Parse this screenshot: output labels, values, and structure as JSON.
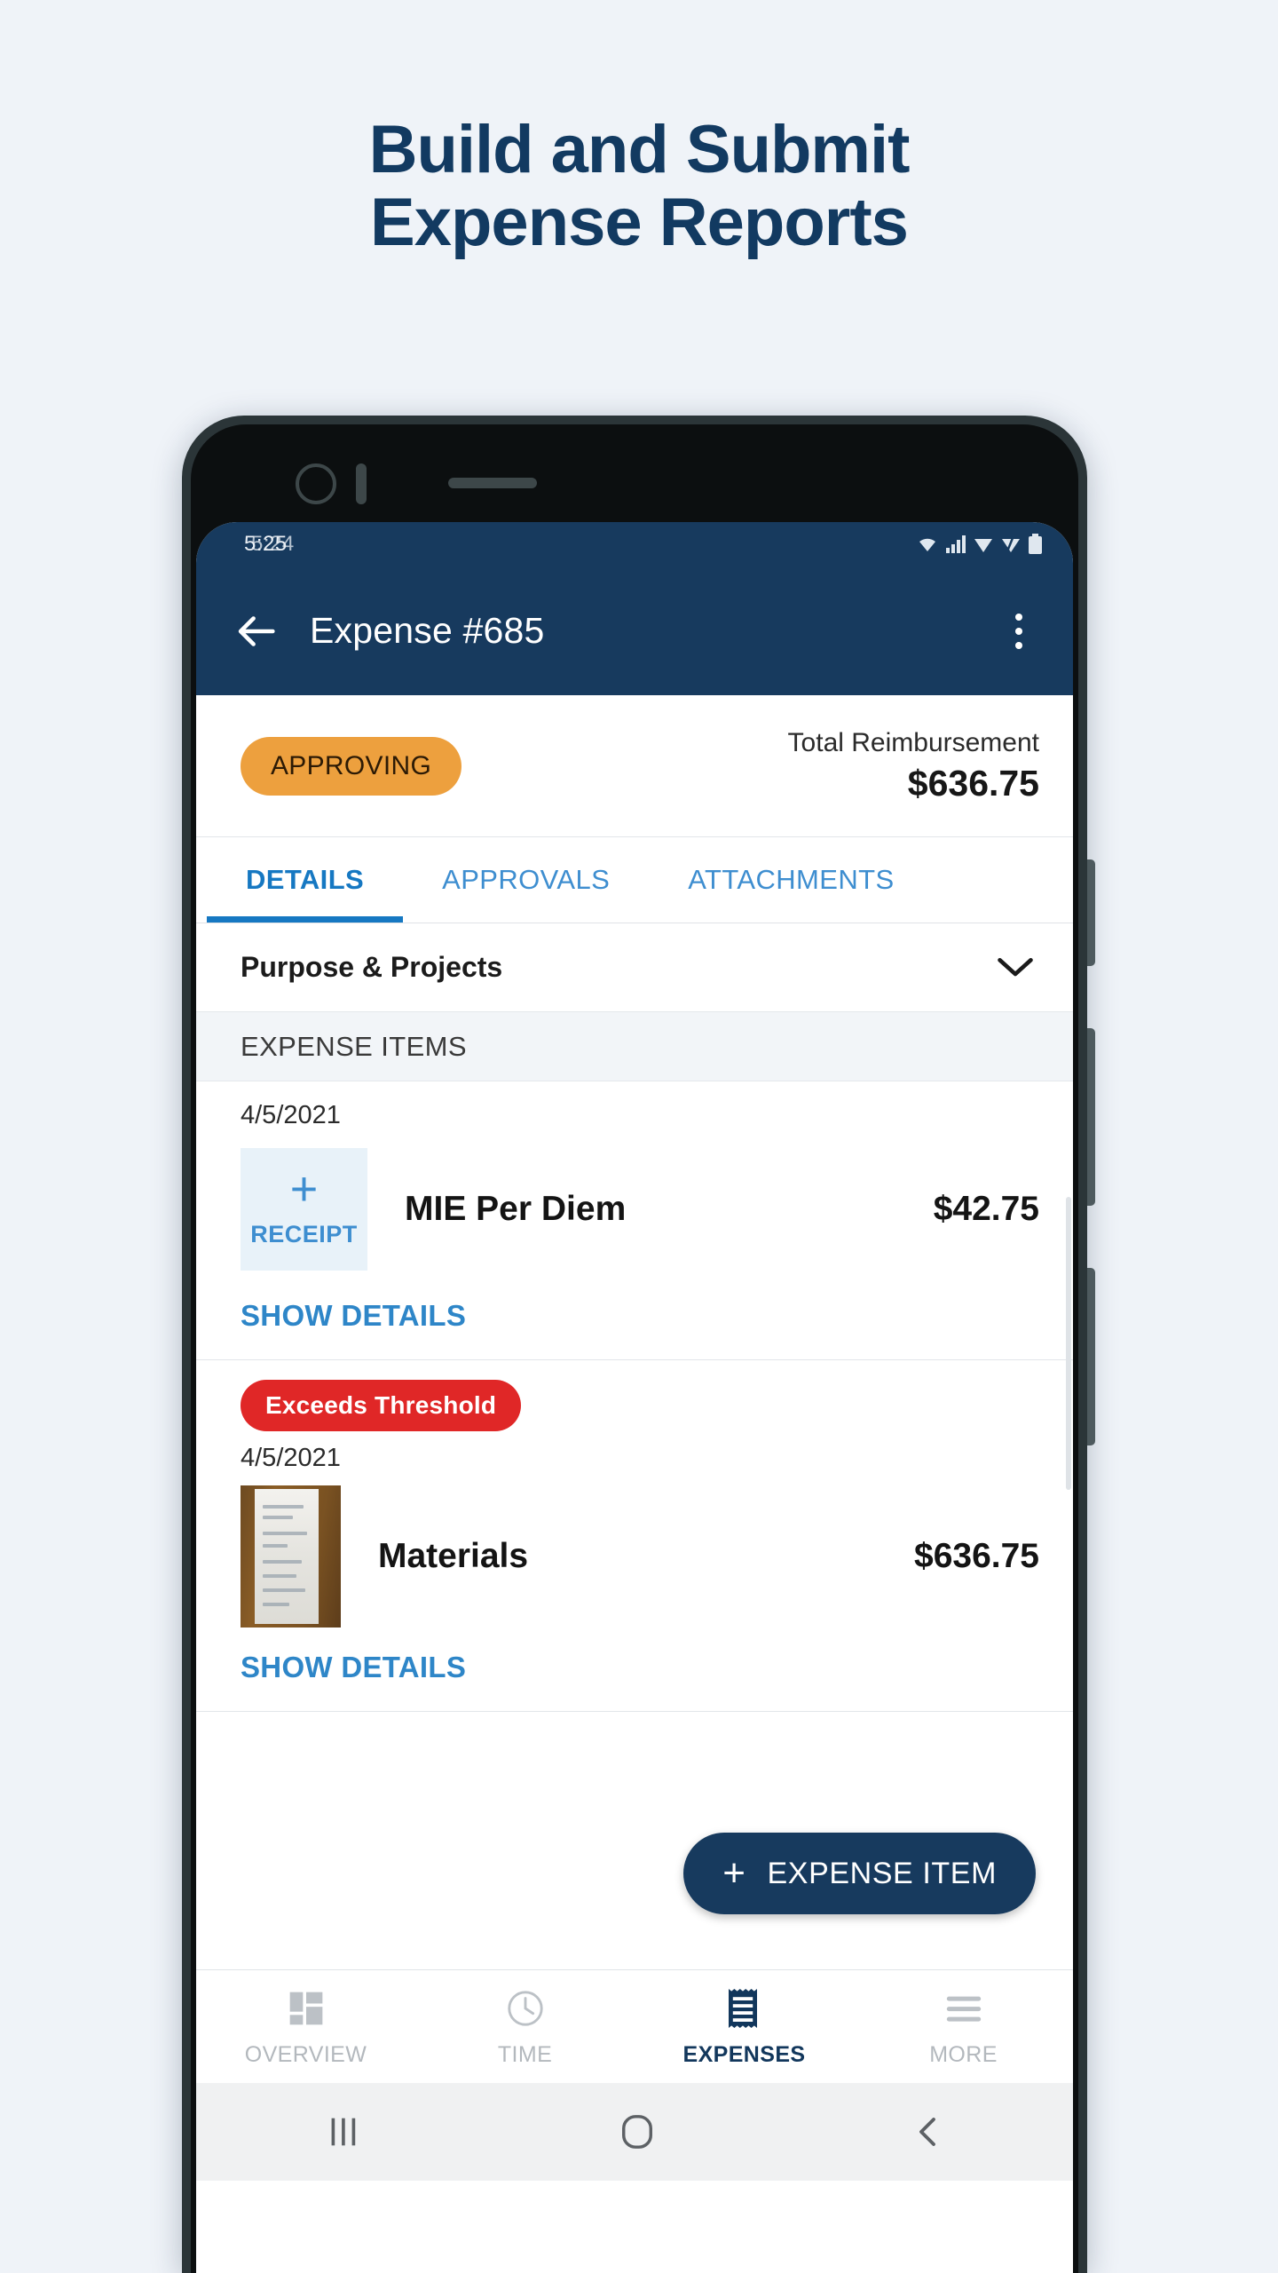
{
  "headline": {
    "line1": "Build and Submit",
    "line2": "Expense Reports",
    "color": "#123a61"
  },
  "phone": {
    "statusbar": {
      "time": "5:25",
      "time_ghost": "5:24",
      "icons": [
        "wifi-icon",
        "signal-icon",
        "signal-icon-2",
        "battery-icon"
      ]
    },
    "appbar": {
      "back_icon": "arrow-left-icon",
      "title": "Expense #685",
      "overflow_icon": "kebab-menu-icon",
      "background": "#173a5e"
    },
    "summary": {
      "status_badge": "APPROVING",
      "status_badge_color": "#eda03e",
      "total_label": "Total Reimbursement",
      "total_amount": "$636.75"
    },
    "tabs": [
      {
        "label": "DETAILS",
        "active": true
      },
      {
        "label": "APPROVALS",
        "active": false
      },
      {
        "label": "ATTACHMENTS",
        "active": false
      }
    ],
    "accordion": {
      "label": "Purpose & Projects",
      "chevron_icon": "chevron-down-icon"
    },
    "section_header": "EXPENSE ITEMS",
    "expense_items": [
      {
        "date": "4/5/2021",
        "name": "MIE Per Diem",
        "amount": "$42.75",
        "thumb_type": "add-receipt",
        "thumb_plus": "+",
        "thumb_caption": "RECEIPT",
        "badge": null,
        "show_details": "SHOW DETAILS"
      },
      {
        "date": "4/5/2021",
        "name": "Materials",
        "amount": "$636.75",
        "thumb_type": "photo",
        "badge": "Exceeds Threshold",
        "badge_color": "#e02727",
        "show_details": "SHOW DETAILS"
      }
    ],
    "fab": {
      "plus": "+",
      "label": "EXPENSE ITEM",
      "color": "#173a5e"
    },
    "bottom_nav": [
      {
        "label": "OVERVIEW",
        "icon": "dashboard-icon",
        "active": false
      },
      {
        "label": "TIME",
        "icon": "clock-icon",
        "active": false
      },
      {
        "label": "EXPENSES",
        "icon": "receipt-icon",
        "active": true
      },
      {
        "label": "MORE",
        "icon": "hamburger-icon",
        "active": false
      }
    ],
    "system_nav": {
      "recents_icon": "recents-icon",
      "home_icon": "home-icon",
      "back_icon": "system-back-icon"
    }
  }
}
